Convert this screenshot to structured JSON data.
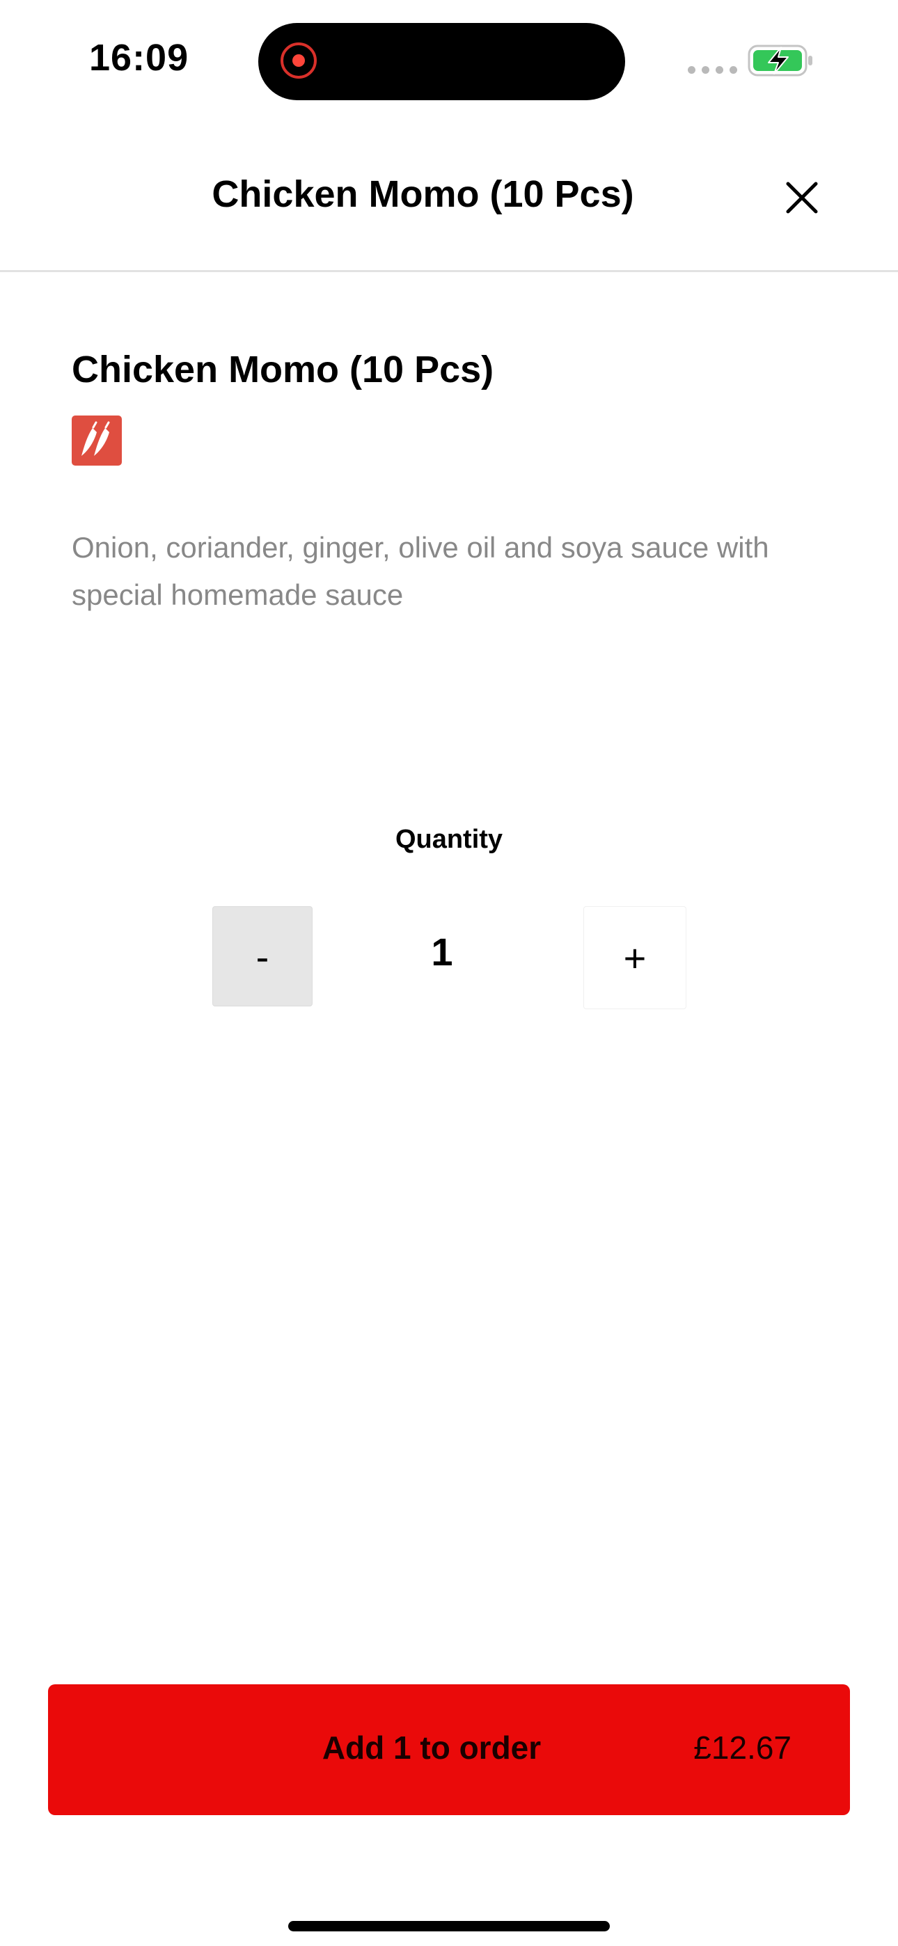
{
  "status_bar": {
    "time": "16:09",
    "battery_color": "#34c759"
  },
  "header": {
    "title": "Chicken Momo (10 Pcs)",
    "close_icon": "close-icon"
  },
  "item": {
    "name": "Chicken Momo (10 Pcs)",
    "badge_icon": "chili-icon",
    "badge_color": "#df4e40",
    "description": "Onion, coriander, ginger, olive oil and soya sauce with special homemade sauce"
  },
  "quantity": {
    "label": "Quantity",
    "minus_label": "-",
    "value": "1",
    "plus_label": "+"
  },
  "order_button": {
    "label": "Add 1 to order",
    "price": "£12.67",
    "color": "#ea0a0a"
  }
}
